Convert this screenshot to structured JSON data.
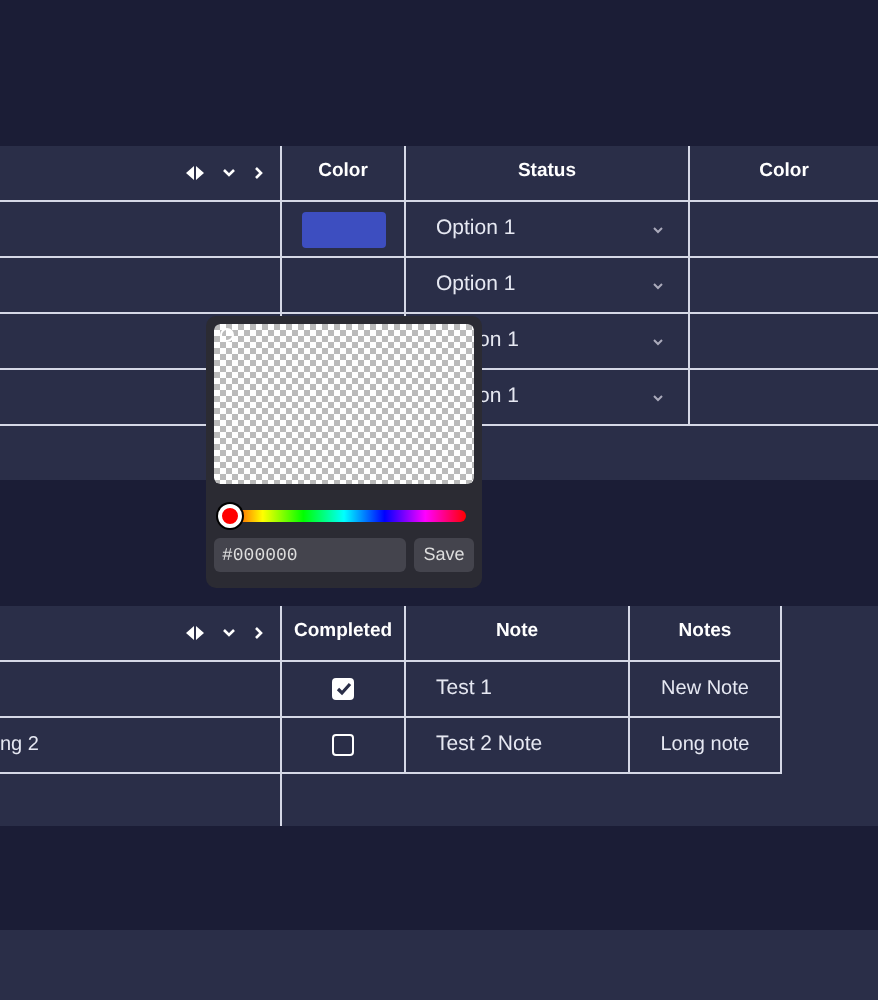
{
  "table_top": {
    "columns": [
      "Color",
      "Status",
      "Color"
    ],
    "rows": [
      {
        "color": "#3d4ec0",
        "status": "Option 1"
      },
      {
        "status": "Option 1"
      },
      {
        "status": "on 1"
      },
      {
        "status": "on 1"
      }
    ]
  },
  "color_picker": {
    "hue": {
      "level": 0
    },
    "hex_value": "#000000",
    "button": "Save"
  },
  "table_bottom": {
    "columns": [
      "Completed",
      "Note",
      "Notes"
    ],
    "rows": [
      {
        "completed": true,
        "note": "Test 1",
        "notes": "New Note"
      },
      {
        "column_1": "ng 2",
        "completed": false,
        "note": "Test 2 Note",
        "notes": "Long note"
      }
    ]
  }
}
